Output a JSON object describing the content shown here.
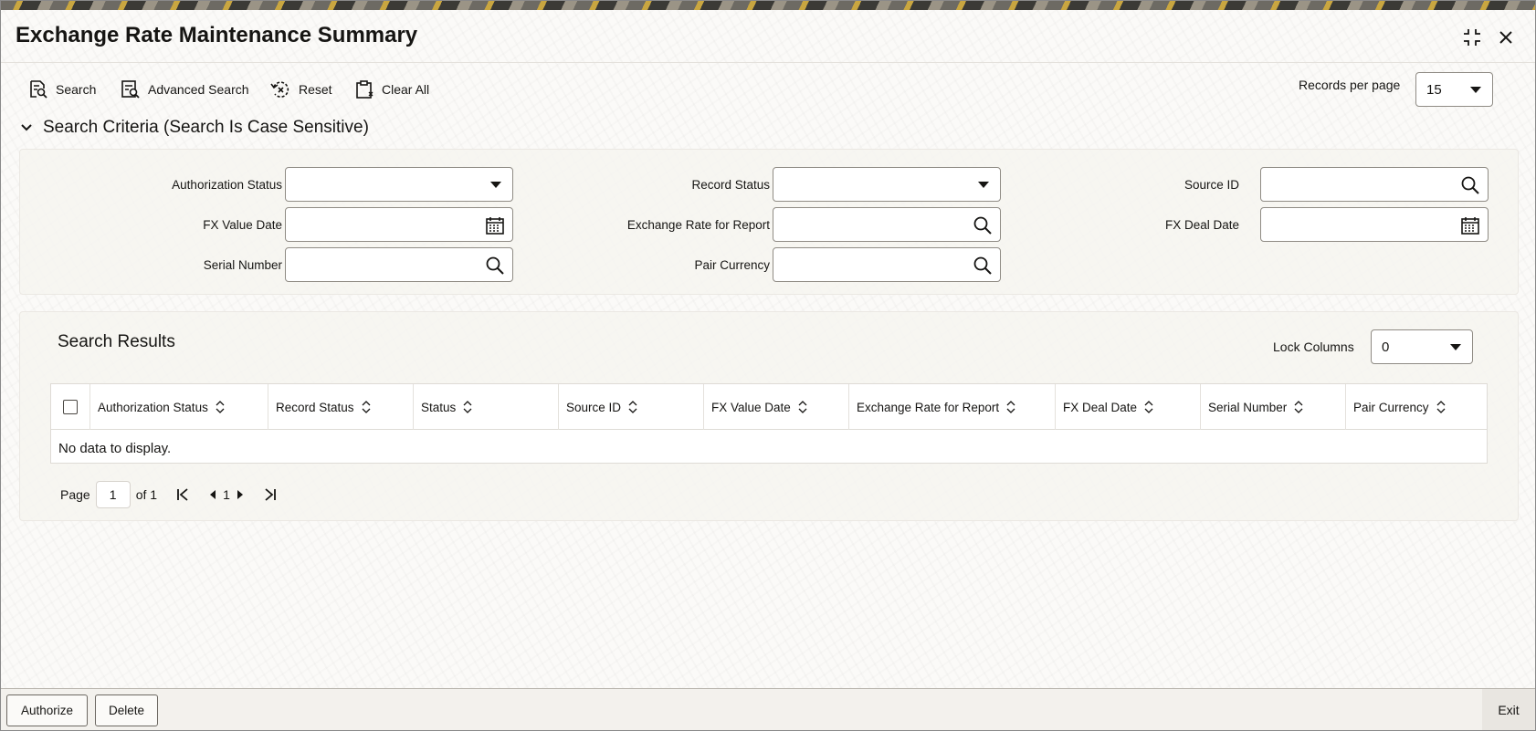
{
  "window": {
    "title": "Exchange Rate Maintenance Summary"
  },
  "toolbar": {
    "search_label": "Search",
    "advanced_search_label": "Advanced Search",
    "reset_label": "Reset",
    "clear_all_label": "Clear All",
    "records_per_page_label": "Records per page",
    "records_per_page_value": "15"
  },
  "criteria": {
    "heading": "Search Criteria (Search Is Case Sensitive)",
    "fields": {
      "authorization_status": {
        "label": "Authorization Status",
        "value": ""
      },
      "record_status": {
        "label": "Record Status",
        "value": ""
      },
      "source_id": {
        "label": "Source ID",
        "value": ""
      },
      "fx_value_date": {
        "label": "FX Value Date",
        "value": ""
      },
      "exchange_rate_for_report": {
        "label": "Exchange Rate for Report",
        "value": ""
      },
      "fx_deal_date": {
        "label": "FX Deal Date",
        "value": ""
      },
      "serial_number": {
        "label": "Serial Number",
        "value": ""
      },
      "pair_currency": {
        "label": "Pair Currency",
        "value": ""
      }
    }
  },
  "results": {
    "heading": "Search Results",
    "lock_columns_label": "Lock Columns",
    "lock_columns_value": "0",
    "columns": [
      "Authorization Status",
      "Record Status",
      "Status",
      "Source ID",
      "FX Value Date",
      "Exchange Rate for Report",
      "FX Deal Date",
      "Serial Number",
      "Pair Currency"
    ],
    "empty_message": "No data to display.",
    "pager": {
      "page_label": "Page",
      "current_page": "1",
      "of_label": "of 1",
      "page_number": "1"
    }
  },
  "footer": {
    "authorize_label": "Authorize",
    "delete_label": "Delete",
    "exit_label": "Exit"
  },
  "colors": {
    "text": "#161513",
    "border": "#8f8b84",
    "panel_bg": "#f6f4f0"
  }
}
